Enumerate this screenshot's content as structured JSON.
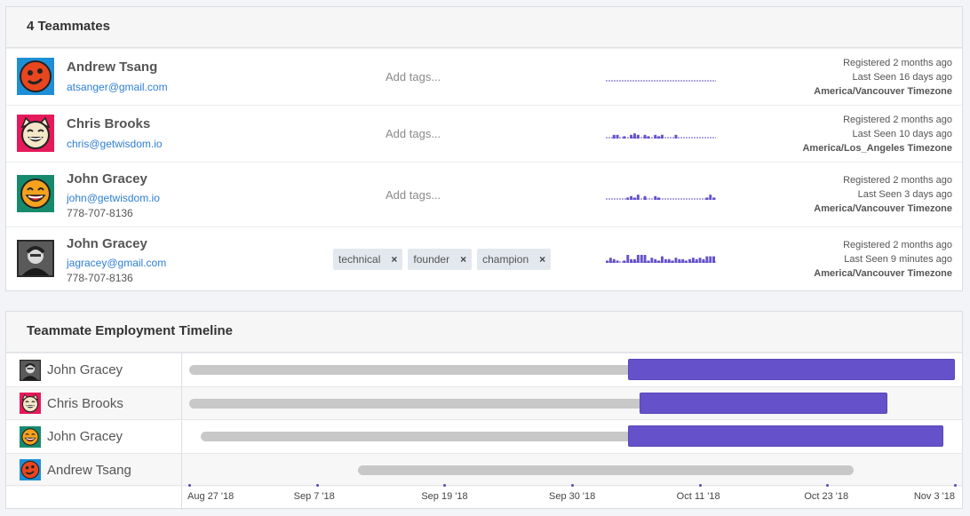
{
  "team_panel": {
    "title": "4 Teammates",
    "members": [
      {
        "name": "Andrew Tsang",
        "email": "atsanger@gmail.com",
        "phone": "",
        "add_tags": "Add tags...",
        "tags": [],
        "registered": "Registered 2 months ago",
        "last_seen": "Last Seen 16 days ago",
        "timezone": "America/Vancouver Timezone",
        "avatar_icon": "red-face-avatar-icon",
        "activity": [
          0,
          0,
          0,
          0,
          0,
          0,
          0,
          0,
          0,
          0,
          0,
          0,
          0,
          0,
          0,
          0,
          0,
          0,
          0,
          0,
          0,
          0,
          0,
          0,
          0,
          0,
          0,
          0,
          0,
          0,
          0,
          0
        ]
      },
      {
        "name": "Chris Brooks",
        "email": "chris@getwisdom.io",
        "phone": "",
        "add_tags": "Add tags...",
        "tags": [],
        "registered": "Registered 2 months ago",
        "last_seen": "Last Seen 10 days ago",
        "timezone": "America/Los_Angeles Timezone",
        "avatar_icon": "cat-laugh-avatar-icon",
        "activity": [
          0,
          0,
          2,
          2,
          0,
          1,
          0,
          2,
          3,
          2,
          0,
          2,
          1,
          0,
          2,
          1,
          2,
          0,
          0,
          0,
          2,
          0,
          0,
          0,
          0,
          0,
          0,
          0,
          0,
          0,
          0,
          0
        ]
      },
      {
        "name": "John Gracey",
        "email": "john@getwisdom.io",
        "phone": "778-707-8136",
        "add_tags": "Add tags...",
        "tags": [],
        "registered": "Registered 2 months ago",
        "last_seen": "Last Seen 3 days ago",
        "timezone": "America/Vancouver Timezone",
        "avatar_icon": "laughing-face-avatar-icon",
        "activity": [
          0,
          0,
          0,
          0,
          0,
          0,
          1,
          2,
          1,
          3,
          0,
          2,
          0,
          0,
          2,
          1,
          0,
          0,
          0,
          0,
          0,
          0,
          0,
          0,
          0,
          0,
          0,
          0,
          0,
          1,
          3,
          1
        ]
      },
      {
        "name": "John Gracey",
        "email": "jagracey@gmail.com",
        "phone": "778-707-8136",
        "add_tags": "",
        "tags": [
          "technical",
          "founder",
          "champion"
        ],
        "registered": "Registered 2 months ago",
        "last_seen": "Last Seen 9 minutes ago",
        "timezone": "America/Vancouver Timezone",
        "avatar_icon": "photo-avatar-icon",
        "activity": [
          1,
          3,
          2,
          1,
          0,
          1,
          5,
          2,
          2,
          5,
          5,
          5,
          1,
          3,
          2,
          1,
          4,
          2,
          2,
          1,
          3,
          2,
          2,
          1,
          2,
          3,
          2,
          3,
          2,
          4,
          4,
          4
        ]
      }
    ]
  },
  "timeline_panel": {
    "title": "Teammate Employment Timeline",
    "rows": [
      {
        "name": "John Gracey",
        "avatar_icon": "photo-avatar-icon",
        "start": "2018-08-27",
        "active_from": "2018-10-05",
        "end": "2018-11-03"
      },
      {
        "name": "Chris Brooks",
        "avatar_icon": "cat-laugh-avatar-icon",
        "start": "2018-08-27",
        "active_from": "2018-10-06",
        "end": "2018-10-28"
      },
      {
        "name": "John Gracey",
        "avatar_icon": "laughing-face-avatar-icon",
        "start": "2018-08-28",
        "active_from": "2018-10-05",
        "end": "2018-11-02"
      },
      {
        "name": "Andrew Tsang",
        "avatar_icon": "red-face-avatar-icon",
        "start": "2018-09-11",
        "active_from": "",
        "end": "2018-10-25"
      }
    ],
    "axis_ticks": [
      "Aug 27 '18",
      "Sep 7 '18",
      "Sep 19 '18",
      "Sep 30 '18",
      "Oct 11 '18",
      "Oct 23 '18",
      "Nov 3 '18"
    ]
  },
  "colors": {
    "accent": "#6551c9",
    "link": "#2d7fd3",
    "bar_gray": "#c8c8c8"
  }
}
